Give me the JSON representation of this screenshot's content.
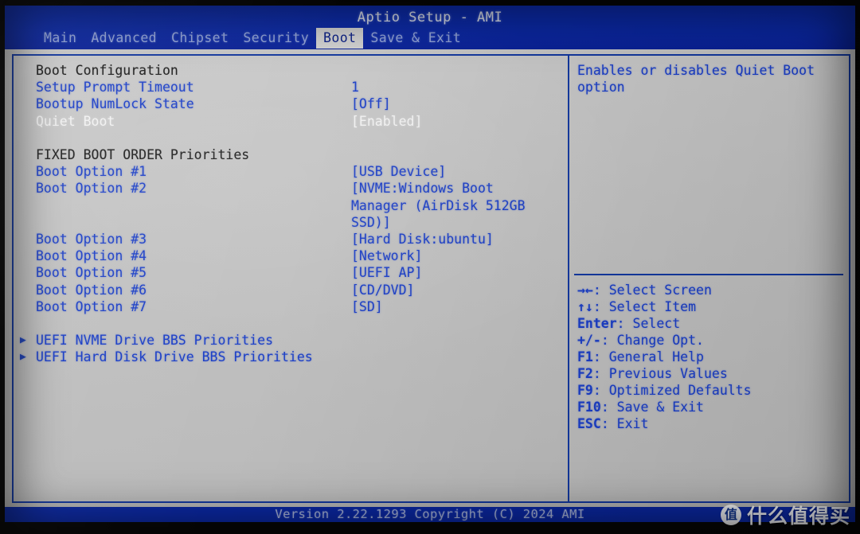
{
  "app": {
    "title": "Aptio Setup - AMI",
    "footer": "Version 2.22.1293 Copyright (C) 2024 AMI"
  },
  "menubar": {
    "tabs": [
      {
        "label": "Main",
        "active": false
      },
      {
        "label": "Advanced",
        "active": false
      },
      {
        "label": "Chipset",
        "active": false
      },
      {
        "label": "Security",
        "active": false
      },
      {
        "label": "Boot",
        "active": true
      },
      {
        "label": "Save & Exit",
        "active": false
      }
    ]
  },
  "main": {
    "rows": [
      {
        "label": "Boot Configuration",
        "value": "",
        "style": "header",
        "submenu": false
      },
      {
        "label": "Setup Prompt Timeout",
        "value": "1",
        "style": "option",
        "submenu": false
      },
      {
        "label": "Bootup NumLock State",
        "value": "[Off]",
        "style": "option",
        "submenu": false
      },
      {
        "label": "Quiet Boot",
        "value": "[Enabled]",
        "style": "selected",
        "submenu": false
      },
      {
        "label": "",
        "value": "",
        "style": "option",
        "submenu": false
      },
      {
        "label": "FIXED BOOT ORDER Priorities",
        "value": "",
        "style": "header",
        "submenu": false
      },
      {
        "label": "Boot Option #1",
        "value": "[USB Device]",
        "style": "option",
        "submenu": false
      },
      {
        "label": "Boot Option #2",
        "value": "[NVME:Windows Boot",
        "style": "option",
        "submenu": false
      },
      {
        "label": "",
        "value": "Manager (AirDisk 512GB",
        "style": "option",
        "submenu": false
      },
      {
        "label": "",
        "value": "SSD)]",
        "style": "option",
        "submenu": false
      },
      {
        "label": "Boot Option #3",
        "value": "[Hard Disk:ubuntu]",
        "style": "option",
        "submenu": false
      },
      {
        "label": "Boot Option #4",
        "value": "[Network]",
        "style": "option",
        "submenu": false
      },
      {
        "label": "Boot Option #5",
        "value": "[UEFI AP]",
        "style": "option",
        "submenu": false
      },
      {
        "label": "Boot Option #6",
        "value": "[CD/DVD]",
        "style": "option",
        "submenu": false
      },
      {
        "label": "Boot Option #7",
        "value": "[SD]",
        "style": "option",
        "submenu": false
      },
      {
        "label": "",
        "value": "",
        "style": "option",
        "submenu": false
      },
      {
        "label": "UEFI NVME Drive BBS Priorities",
        "value": "",
        "style": "option",
        "submenu": true
      },
      {
        "label": "UEFI Hard Disk Drive BBS Priorities",
        "value": "",
        "style": "option",
        "submenu": true
      }
    ]
  },
  "help": {
    "description": "Enables or disables Quiet Boot option",
    "legend": [
      {
        "keys": "→←",
        "text": ": Select Screen"
      },
      {
        "keys": "↑↓",
        "text": ": Select Item"
      },
      {
        "keys": "Enter",
        "text": ": Select"
      },
      {
        "keys": "+/-",
        "text": ": Change Opt."
      },
      {
        "keys": "F1",
        "text": ": General Help"
      },
      {
        "keys": "F2",
        "text": ": Previous Values"
      },
      {
        "keys": "F9",
        "text": ": Optimized Defaults"
      },
      {
        "keys": "F10",
        "text": ": Save & Exit"
      },
      {
        "keys": "ESC",
        "text": ": Exit"
      }
    ]
  },
  "watermark": {
    "badge": "值",
    "text": "什么值得买"
  },
  "colors": {
    "header_blue": "#0b29a8",
    "option_blue": "#1b3ec6",
    "panel_border": "#13389f",
    "body_gray": "#c4c4c4",
    "selected_white": "#f2f2f2",
    "section_header": "#1c1c1c"
  }
}
